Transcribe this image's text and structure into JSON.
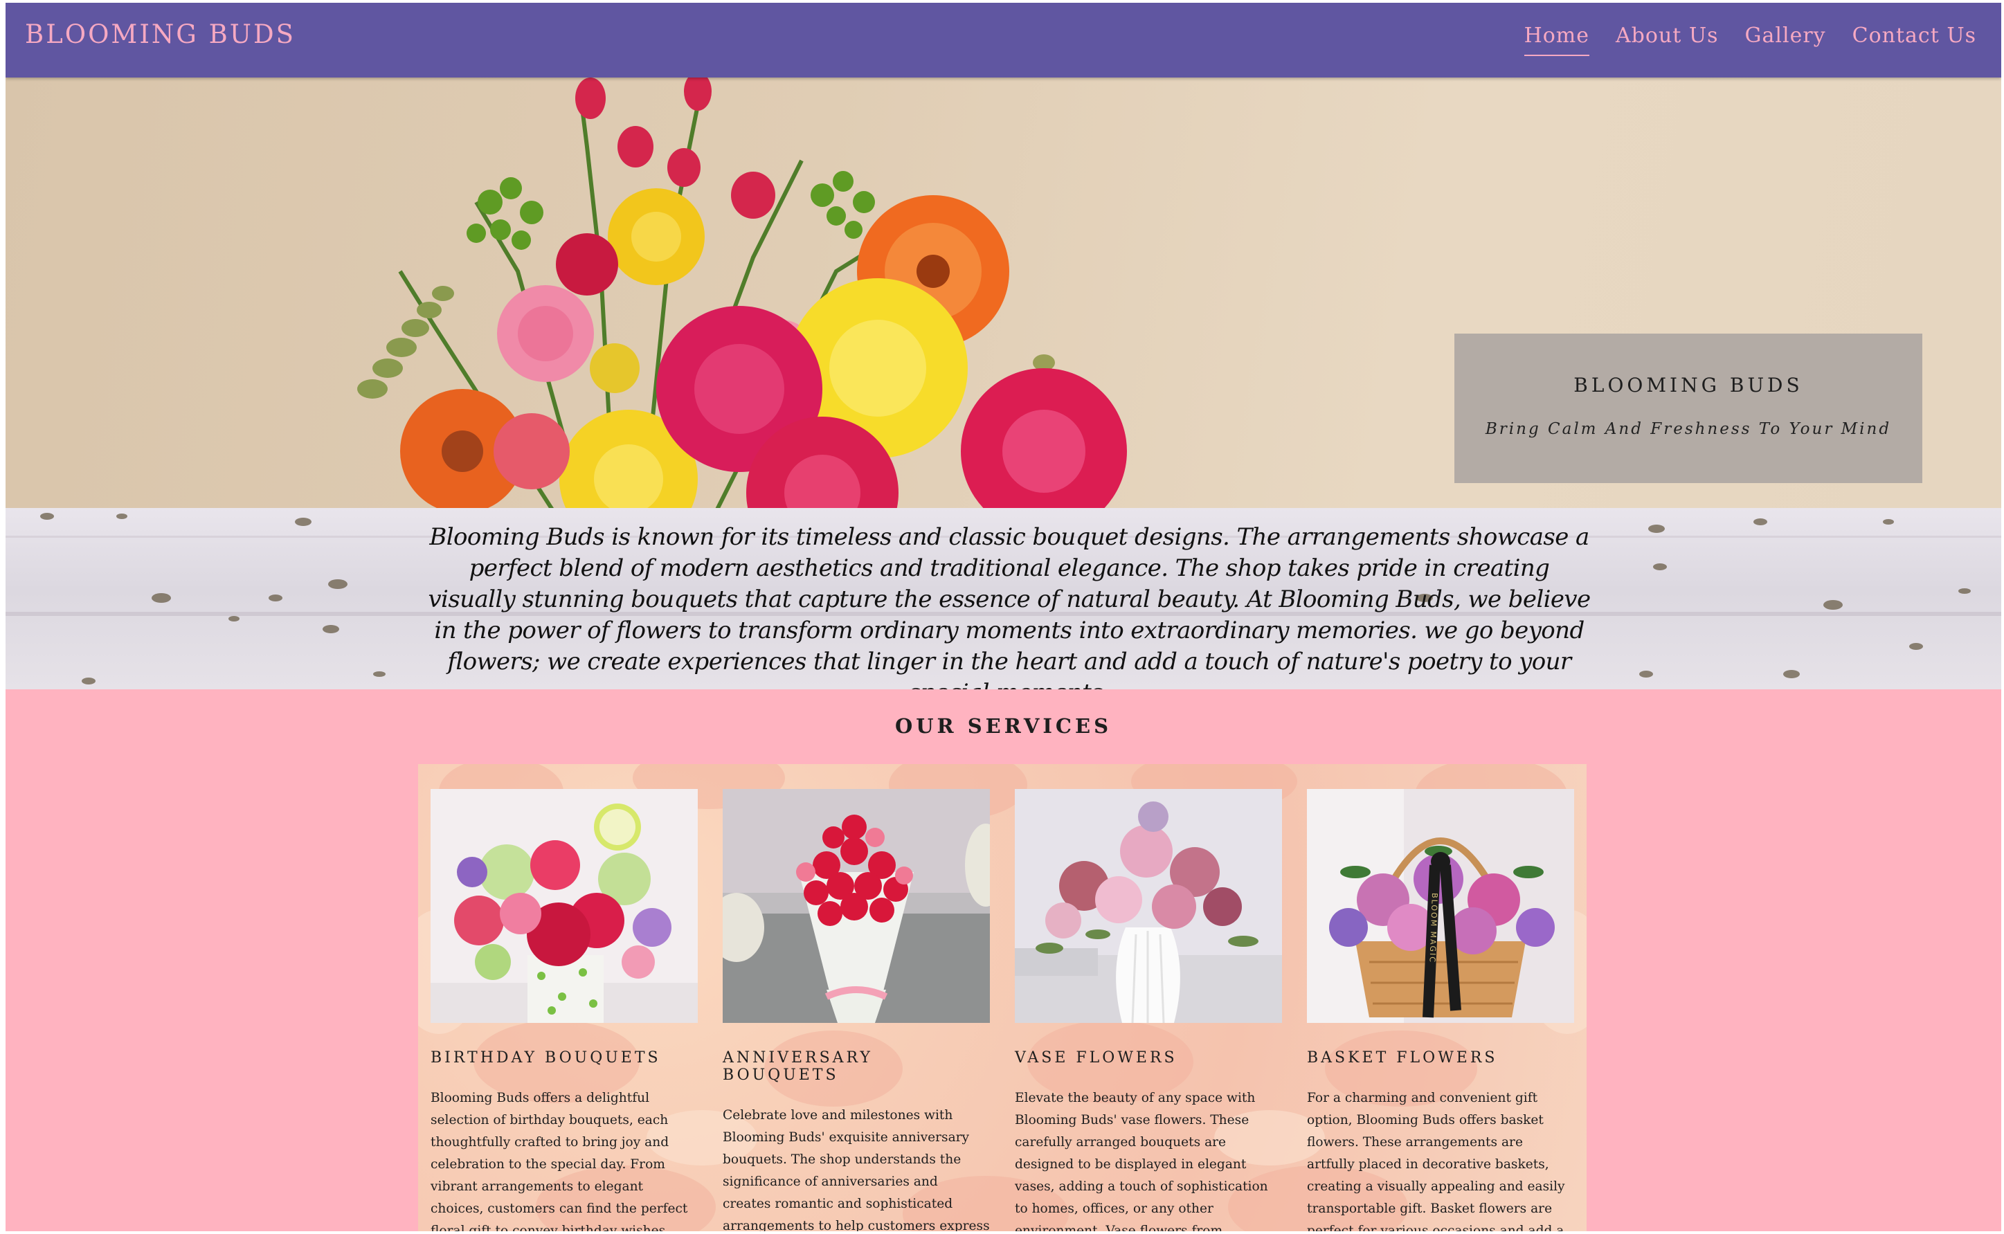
{
  "header": {
    "brand": "BLOOMING BUDS",
    "nav": [
      "Home",
      "About Us",
      "Gallery",
      "Contact Us"
    ],
    "active_nav": "Home"
  },
  "hero": {
    "card_title": "BLOOMING BUDS",
    "card_subtitle": "Bring Calm And Freshness To Your Mind"
  },
  "intro": {
    "text": "Blooming Buds is known for its timeless and classic bouquet designs. The arrangements showcase a perfect blend of modern aesthetics and traditional elegance. The shop takes pride in creating visually stunning bouquets that capture the essence of natural beauty. At Blooming Buds, we believe in the power of flowers to transform ordinary moments into extraordinary memories. we go beyond flowers; we create experiences that linger in the heart and add a touch of nature's poetry to your special moments."
  },
  "services": {
    "title": "OUR SERVICES",
    "items": [
      {
        "title": "BIRTHDAY BOUQUETS",
        "text": "Blooming Buds offers a delightful selection of birthday bouquets, each thoughtfully crafted to bring joy and celebration to the special day. From vibrant arrangements to elegant choices, customers can find the perfect floral gift to convey birthday wishes.",
        "image_icon": "birthday-bouquet-image"
      },
      {
        "title": "ANNIVERSARY BOUQUETS",
        "text": "Celebrate love and milestones with Blooming Buds' exquisite anniversary bouquets. The shop understands the significance of anniversaries and creates romantic and sophisticated arrangements to help customers express their love and commitment.",
        "image_icon": "anniversary-bouquet-image"
      },
      {
        "title": "VASE FLOWERS",
        "text": "Elevate the beauty of any space with Blooming Buds' vase flowers. These carefully arranged bouquets are designed to be displayed in elegant vases, adding a touch of sophistication to homes, offices, or any other environment. Vase flowers from Blooming Buds make for lasting and stylish gifts.",
        "image_icon": "vase-flowers-image"
      },
      {
        "title": "BASKET FLOWERS",
        "text": "For a charming and convenient gift option, Blooming Buds offers basket flowers. These arrangements are artfully placed in decorative baskets, creating a visually appealing and easily transportable gift. Basket flowers are perfect for various occasions and add a touch of charm to any",
        "image_icon": "basket-flowers-image",
        "ribbon_text": "BLOOM MAGIC"
      }
    ]
  },
  "colors": {
    "navbar": "#6056a1",
    "brand_pink": "#f6a9c2",
    "services_bg": "#ffb3c0",
    "hero_card": "#b3aba5"
  }
}
